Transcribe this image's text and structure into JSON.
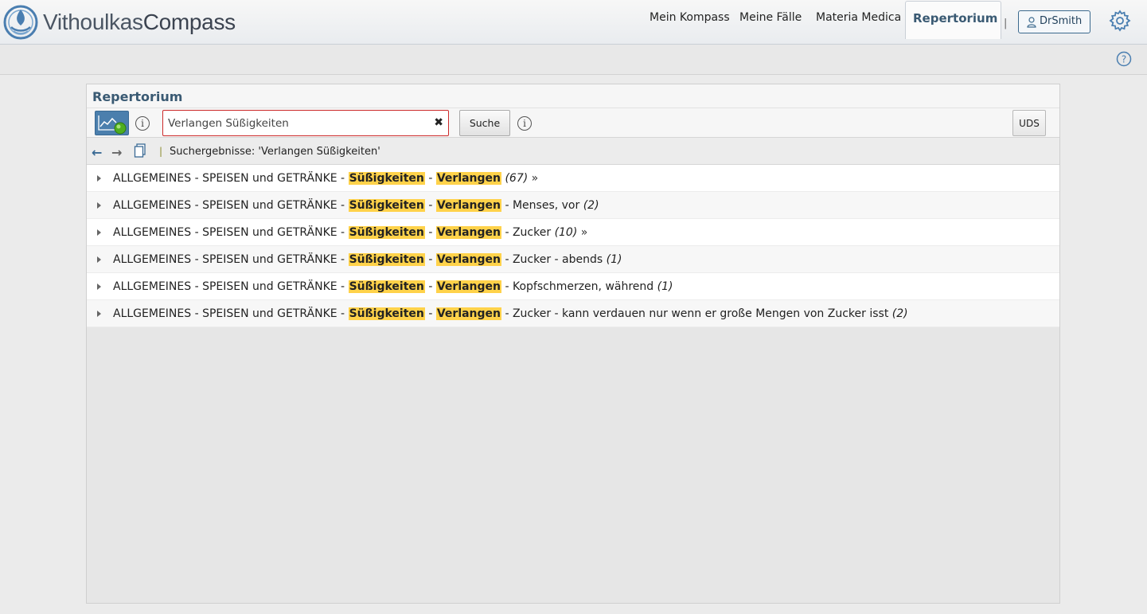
{
  "app": {
    "logo_light": "Vithoulkas",
    "logo_bold": "Compass",
    "logo_icon": "vithoulkas-compass-logo"
  },
  "nav": {
    "items": [
      {
        "label": "Mein Kompass"
      },
      {
        "label": "Meine Fälle"
      },
      {
        "label": "Materia Medica"
      },
      {
        "label": "Repertorium"
      }
    ],
    "separator": "|",
    "user": "DrSmith",
    "user_icon": "user-icon",
    "settings_icon": "gear-icon",
    "help_icon": "help-icon"
  },
  "panel": {
    "title": "Repertorium",
    "search": {
      "value": "Verlangen Süßigkeiten",
      "clear": "✖",
      "button": "Suche"
    },
    "uds": "UDS",
    "results_sep": "|",
    "results_label": "Suchergebnisse: 'Verlangen Süßigkeiten'"
  },
  "results": [
    {
      "prefix": "ALLGEMEINES - SPEISEN und GETRÄNKE - ",
      "hl1": "Süßigkeiten",
      "mid": " - ",
      "hl2": "Verlangen",
      "suffix": " ",
      "count": "(67)",
      "more": " »"
    },
    {
      "prefix": "ALLGEMEINES - SPEISEN und GETRÄNKE - ",
      "hl1": "Süßigkeiten",
      "mid": " - ",
      "hl2": "Verlangen",
      "suffix": " - Menses, vor ",
      "count": "(2)",
      "more": ""
    },
    {
      "prefix": "ALLGEMEINES - SPEISEN und GETRÄNKE - ",
      "hl1": "Süßigkeiten",
      "mid": " - ",
      "hl2": "Verlangen",
      "suffix": " - Zucker ",
      "count": "(10)",
      "more": " »"
    },
    {
      "prefix": "ALLGEMEINES - SPEISEN und GETRÄNKE - ",
      "hl1": "Süßigkeiten",
      "mid": " - ",
      "hl2": "Verlangen",
      "suffix": " - Zucker - abends ",
      "count": "(1)",
      "more": ""
    },
    {
      "prefix": "ALLGEMEINES - SPEISEN und GETRÄNKE - ",
      "hl1": "Süßigkeiten",
      "mid": " - ",
      "hl2": "Verlangen",
      "suffix": " - Kopfschmerzen, während ",
      "count": "(1)",
      "more": ""
    },
    {
      "prefix": "ALLGEMEINES - SPEISEN und GETRÄNKE - ",
      "hl1": "Süßigkeiten",
      "mid": " - ",
      "hl2": "Verlangen",
      "suffix": " - Zucker - kann verdauen nur wenn er große Mengen von Zucker isst ",
      "count": "(2)",
      "more": ""
    }
  ],
  "colors": {
    "accent": "#3a5a73",
    "highlight": "#ffd24a",
    "search_border": "#cc2a2a"
  }
}
